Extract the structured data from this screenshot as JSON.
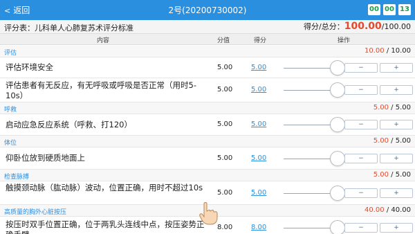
{
  "header": {
    "back_chevron": "<",
    "back_label": "返回",
    "title": "2号(20200730002)",
    "timer": [
      "00",
      "00",
      "13"
    ]
  },
  "score_header": {
    "sheet_label": "评分表：儿科单人心肺复苏术评分标准",
    "total_label": "得分/总分：",
    "score": "100.00",
    "total": "/100.00"
  },
  "columns": {
    "content": "内容",
    "max": "分值",
    "got": "得分",
    "action": "操作"
  },
  "minus_label": "−",
  "plus_label": "+",
  "sections": [
    {
      "name": "评估",
      "got": "10.00",
      "max": " / 10.00",
      "items": [
        {
          "text": "评估环境安全",
          "max": "5.00",
          "got": "5.00",
          "level": 1
        },
        {
          "text": "评估患者有无反应，有无呼吸或呼吸是否正常（用时5-10s）",
          "max": "5.00",
          "got": "5.00",
          "level": 1
        }
      ]
    },
    {
      "name": "呼救",
      "got": "5.00",
      "max": " / 5.00",
      "items": [
        {
          "text": "启动应急反应系统（呼救、打120）",
          "max": "5.00",
          "got": "5.00",
          "level": 1
        }
      ]
    },
    {
      "name": "体位",
      "got": "5.00",
      "max": " / 5.00",
      "items": [
        {
          "text": "仰卧位放到硬质地面上",
          "max": "5.00",
          "got": "5.00",
          "level": 1
        }
      ]
    },
    {
      "name": "检查脉搏",
      "got": "5.00",
      "max": " / 5.00",
      "items": [
        {
          "text": "触摸颈动脉（肱动脉）波动，位置正确，用时不超过10s",
          "max": "5.00",
          "got": "5.00",
          "level": 1
        }
      ]
    },
    {
      "name": "高质量的胸外心脏按压",
      "got": "40.00",
      "max": " / 40.00",
      "items": [
        {
          "text": "按压时双手位置正确，位于两乳头连线中点，按压姿势正确手臂",
          "max": "8.00",
          "got": "8.00",
          "level": 1
        }
      ]
    }
  ],
  "colors": {
    "accent": "#2b8fe0",
    "score_red": "#e04b2f",
    "timer_green": "#17a14a"
  }
}
